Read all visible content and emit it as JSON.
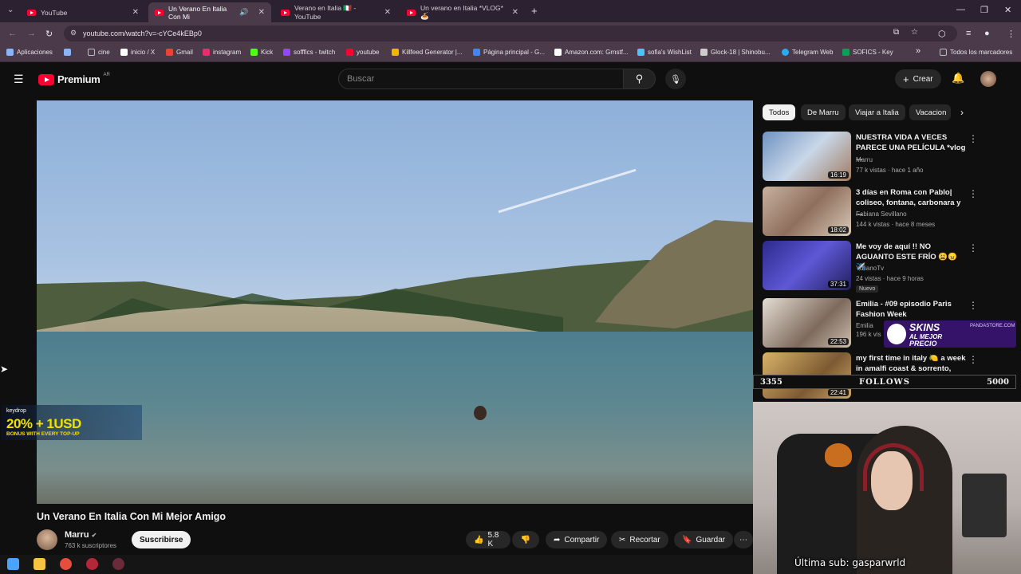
{
  "browser": {
    "tabs": [
      {
        "label": "YouTube",
        "active": false
      },
      {
        "label": "Un Verano En Italia Con Mi",
        "active": true
      },
      {
        "label": "Verano en Italia 🇮🇹 - YouTube",
        "active": false
      },
      {
        "label": "Un verano en Italia *VLOG* 🍝",
        "active": false
      }
    ],
    "new_tab": "+",
    "url": "youtube.com/watch?v=-cYCe4kEBp0",
    "bookmarks": [
      {
        "label": "Aplicaciones",
        "color": "#8ab4f8"
      },
      {
        "label": "",
        "color": "#8ab4f8"
      },
      {
        "label": "cine",
        "color": "#bdbdbd"
      },
      {
        "label": "inicio / X",
        "color": "#ffffff"
      },
      {
        "label": "Gmail",
        "color": "#ea4335"
      },
      {
        "label": "instagram",
        "color": "#e1306c"
      },
      {
        "label": "Kick",
        "color": "#53fc18"
      },
      {
        "label": "sofffics - twitch",
        "color": "#9146ff"
      },
      {
        "label": "youtube",
        "color": "#ff0033"
      },
      {
        "label": "Killfeed Generator |...",
        "color": "#f4b400"
      },
      {
        "label": "Página principal - G...",
        "color": "#4285f4"
      },
      {
        "label": "Amazon.com: Grnstf...",
        "color": "#ffffff"
      },
      {
        "label": "sofia's WishList",
        "color": "#4fc3f7"
      },
      {
        "label": "Glock-18 | Shinobu...",
        "color": "#cccccc"
      },
      {
        "label": "Telegram Web",
        "color": "#2aabee"
      },
      {
        "label": "SOFICS - Key",
        "color": "#0f9d58"
      }
    ],
    "bookmarks_more": "»",
    "all_bookmarks": "Todos los marcadores"
  },
  "youtube": {
    "logo": "Premium",
    "country": "AR",
    "search_placeholder": "Buscar",
    "create_label": "Crear"
  },
  "video": {
    "title": "Un Verano En Italia Con Mi Mejor Amigo",
    "channel": "Marru",
    "subscribers": "763 k suscriptores",
    "subscribe_label": "Suscribirse",
    "likes": "5.8 K",
    "share_label": "Compartir",
    "clip_label": "Recortar",
    "save_label": "Guardar",
    "more_label": "⋯"
  },
  "chips": [
    "Todos",
    "De Marru",
    "Viajar a Italia",
    "Vacacion"
  ],
  "recommendations": [
    {
      "title": "NUESTRA VIDA A VECES PARECE UNA PELÍCULA *vlog ...",
      "channel": "Marru",
      "meta": "77 k vistas · hace 1 año",
      "duration": "16:19",
      "thumb_color": "#7fa0c8"
    },
    {
      "title": "3 días en Roma con Pablo| coliseo, fontana, carbonara y ...",
      "channel": "Fabiana Sevillano",
      "meta": "144 k vistas · hace 8 meses",
      "duration": "18:02",
      "thumb_color": "#b79a86"
    },
    {
      "title": "Me voy de aquí !! NO AGUANTO ESTE FRÍO 😩😠 ✈️",
      "channel": "YulianoTv",
      "meta": "24 vistas · hace 9 horas",
      "badge": "Nuevo",
      "duration": "37:31",
      "thumb_color": "#3f3aa8"
    },
    {
      "title": "Emilia - #09 episodio Paris Fashion Week",
      "channel": "Emilia",
      "meta": "196 k vis",
      "duration": "22:53",
      "thumb_color": "#d2c8bd"
    },
    {
      "title": "my first time in italy 🍋 a week in amalfi coast & sorrento, girl...",
      "channel": "",
      "meta": "",
      "duration": "22:41",
      "thumb_color": "#a88a5a"
    }
  ],
  "overlays": {
    "keydrop_brand": "keydrop",
    "keydrop_promo": "20% + 1USD",
    "keydrop_sub": "BONUS WITH EVERY TOP-UP",
    "skins_line1": "SKINS",
    "skins_line2": "AL MEJOR",
    "skins_line3": "PRECIO",
    "skins_store": "PANDASTORE.COM",
    "follows_current": "3355",
    "follows_label": "FOLLOWS",
    "follows_goal": "5000",
    "last_sub": "Última sub: gasparwrld"
  }
}
